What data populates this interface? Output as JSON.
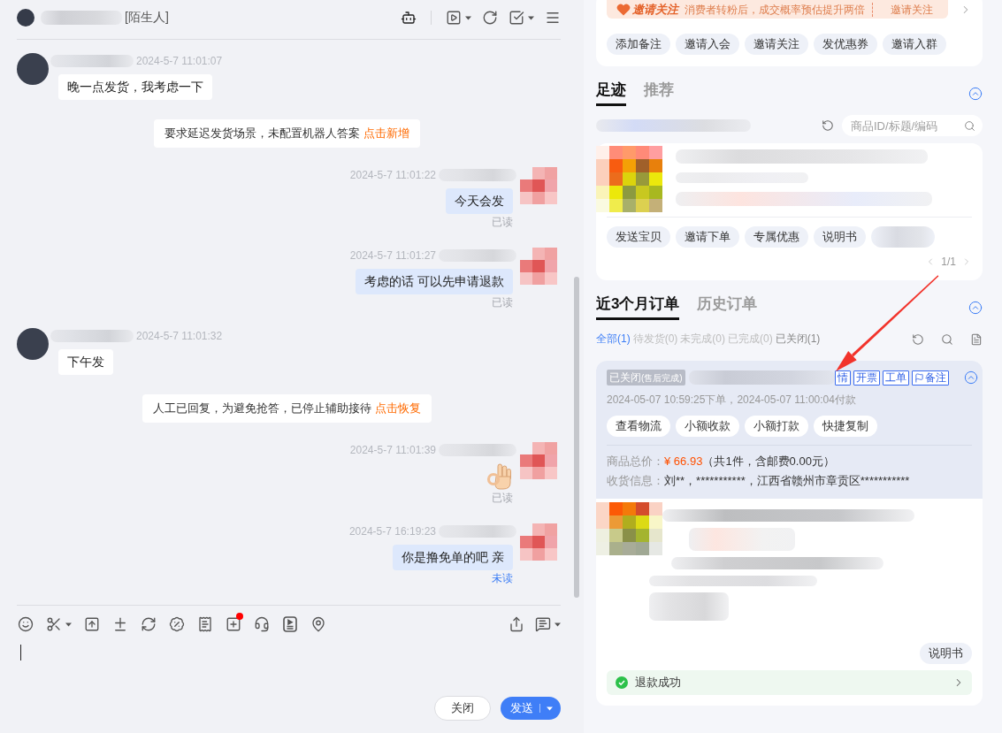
{
  "chat_header": {
    "contact_tag": "[陌生人]"
  },
  "messages": [
    {
      "kind": "incoming",
      "time": "2024-5-7 11:01:07",
      "text": "晚一点发货，我考虑一下"
    },
    {
      "kind": "notice",
      "text": "要求延迟发货场景，未配置机器人答案",
      "action": "点击新增"
    },
    {
      "kind": "outgoing",
      "time": "2024-5-7 11:01:22",
      "text": "今天会发",
      "status": "已读",
      "read": true
    },
    {
      "kind": "outgoing",
      "time": "2024-5-7 11:01:27",
      "text": "考虑的话 可以先申请退款",
      "status": "已读",
      "read": true
    },
    {
      "kind": "incoming",
      "time": "2024-5-7 11:01:32",
      "text": "下午发"
    },
    {
      "kind": "notice",
      "text": "人工已回复，为避免抢答，已停止辅助接待",
      "action": "点击恢复"
    },
    {
      "kind": "sticker",
      "time": "2024-5-7 11:01:39",
      "status": "已读",
      "read": true
    },
    {
      "kind": "outgoing",
      "time": "2024-5-7 16:19:23",
      "text": "你是撸免单的吧 亲",
      "status": "未读",
      "read": false
    }
  ],
  "composer": {
    "tools": [
      {
        "kind": "emoji",
        "menu": false,
        "badge": false
      },
      {
        "kind": "scissors",
        "menu": true,
        "badge": false
      },
      {
        "kind": "upload",
        "menu": false,
        "badge": false
      },
      {
        "kind": "calc",
        "menu": false,
        "badge": false
      },
      {
        "kind": "exchange",
        "menu": false,
        "badge": false
      },
      {
        "kind": "coupon",
        "menu": false,
        "badge": false
      },
      {
        "kind": "receipt",
        "menu": false,
        "badge": false
      },
      {
        "kind": "add",
        "menu": false,
        "badge": true
      },
      {
        "kind": "service",
        "menu": false,
        "badge": false
      },
      {
        "kind": "video_doc",
        "menu": false,
        "badge": false
      },
      {
        "kind": "location",
        "menu": false,
        "badge": false
      }
    ],
    "side_tools": [
      {
        "kind": "share",
        "menu": false,
        "badge": false
      },
      {
        "kind": "quick_reply",
        "menu": true,
        "badge": false
      }
    ],
    "buttons": [
      {
        "label": "关闭",
        "kind": "secondary"
      },
      {
        "label": "发送",
        "kind": "primary"
      }
    ]
  },
  "customer_card": {
    "promo": {
      "brand": "邀请关注",
      "text": "消费者转粉后，成交概率预估提升两倍",
      "action": "邀请关注"
    },
    "actions": [
      "添加备注",
      "邀请入会",
      "邀请关注",
      "发优惠券",
      "邀请入群"
    ]
  },
  "footprint": {
    "tabs": [
      {
        "label": "足迹",
        "selected": true
      },
      {
        "label": "推荐",
        "selected": false
      }
    ],
    "search": {
      "placeholder": "商品ID/标题/编码"
    },
    "product_actions": [
      "发送宝贝",
      "邀请下单",
      "专属优惠",
      "说明书"
    ],
    "pager": "1/1"
  },
  "orders": {
    "tabs": [
      {
        "label": "近3个月订单",
        "selected": true
      },
      {
        "label": "历史订单",
        "selected": false
      }
    ],
    "filters": [
      {
        "label": "全部(1)",
        "selected": true,
        "disabled": false
      },
      {
        "label": "待发货(0)",
        "selected": false,
        "disabled": true
      },
      {
        "label": "未完成(0)",
        "selected": false,
        "disabled": true
      },
      {
        "label": "已完成(0)",
        "selected": false,
        "disabled": true
      },
      {
        "label": "已关闭(1)",
        "selected": false,
        "disabled": false
      }
    ],
    "order": {
      "status": "已关闭",
      "status_note": "(售后完成)",
      "tags": [
        {
          "label": "情",
          "kind": "text"
        },
        {
          "label": "开票",
          "kind": "text"
        },
        {
          "label": "工单",
          "kind": "text"
        },
        {
          "label": "备注",
          "kind": "flag"
        }
      ],
      "times": "2024-05-07 10:59:25下单，2024-05-07 11:00:04付款",
      "actions": [
        "查看物流",
        "小额收款",
        "小额打款",
        "快捷复制"
      ],
      "total_label": "商品总价：",
      "total_price": "¥ 66.93",
      "total_note": "（共1件，含邮费0.00元）",
      "shipping_label": "收货信息：",
      "shipping": "刘**，***********，江西省赣州市章贡区***********",
      "item_action": "说明书",
      "refund": "退款成功"
    }
  }
}
